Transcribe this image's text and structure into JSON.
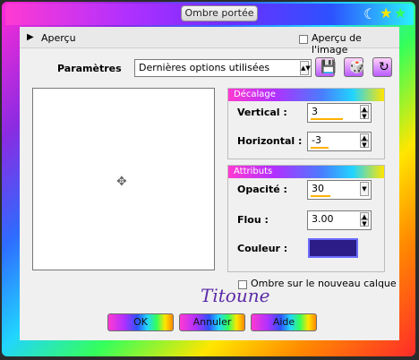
{
  "dialog": {
    "title": "Ombre portée",
    "top": {
      "preview_label": "Aperçu",
      "preview_checkbox_label": "Aperçu de l'image"
    },
    "params": {
      "label": "Paramètres",
      "preset_value": "Dernières options utilisées"
    },
    "offset": {
      "header": "Décalage",
      "vertical_label": "Vertical :",
      "vertical_value": "3",
      "horizontal_label": "Horizontal :",
      "horizontal_value": "-3"
    },
    "attributes": {
      "header": "Attributs",
      "opacity_label": "Opacité :",
      "opacity_value": "30",
      "blur_label": "Flou :",
      "blur_value": "3.00",
      "color_label": "Couleur :",
      "color_hex": "#2b1c88"
    },
    "new_layer_label": "Ombre sur le nouveau calque",
    "watermark": "Titoune",
    "buttons": {
      "ok": "OK",
      "cancel": "Annuler",
      "help": "Aide"
    }
  }
}
